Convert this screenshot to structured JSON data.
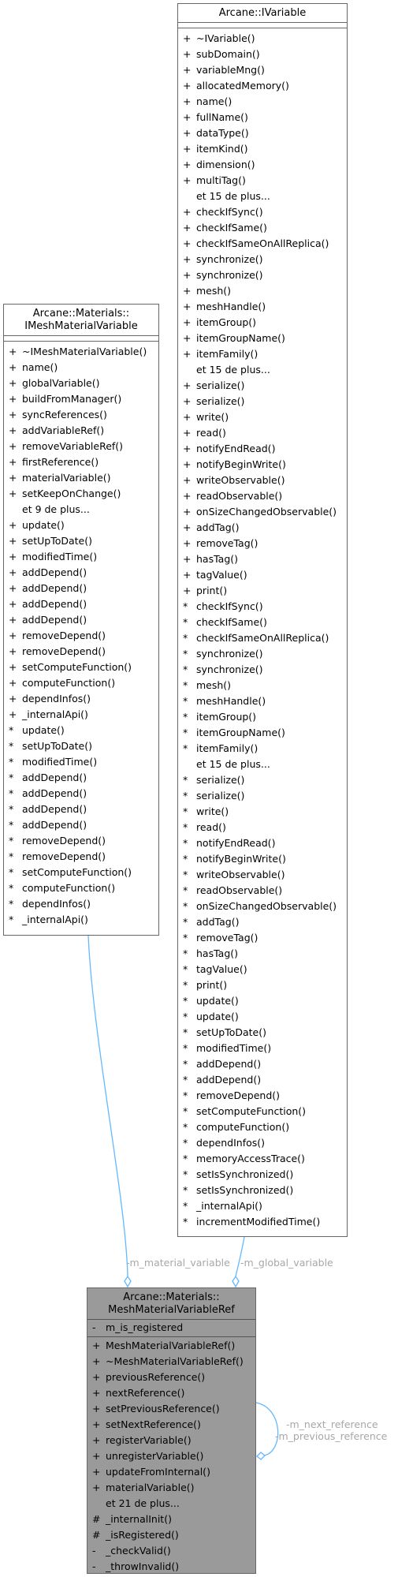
{
  "ivariable": {
    "title": "Arcane::IVariable",
    "methods": [
      {
        "v": "+",
        "n": "~IVariable()"
      },
      {
        "v": "+",
        "n": "subDomain()"
      },
      {
        "v": "+",
        "n": "variableMng()"
      },
      {
        "v": "+",
        "n": "allocatedMemory()"
      },
      {
        "v": "+",
        "n": "name()"
      },
      {
        "v": "+",
        "n": "fullName()"
      },
      {
        "v": "+",
        "n": "dataType()"
      },
      {
        "v": "+",
        "n": "itemKind()"
      },
      {
        "v": "+",
        "n": "dimension()"
      },
      {
        "v": "+",
        "n": "multiTag()"
      },
      {
        "v": "",
        "n": "et 15 de plus..."
      },
      {
        "v": "+",
        "n": "checkIfSync()"
      },
      {
        "v": "+",
        "n": "checkIfSame()"
      },
      {
        "v": "+",
        "n": "checkIfSameOnAllReplica()"
      },
      {
        "v": "+",
        "n": "synchronize()"
      },
      {
        "v": "+",
        "n": "synchronize()"
      },
      {
        "v": "+",
        "n": "mesh()"
      },
      {
        "v": "+",
        "n": "meshHandle()"
      },
      {
        "v": "+",
        "n": "itemGroup()"
      },
      {
        "v": "+",
        "n": "itemGroupName()"
      },
      {
        "v": "+",
        "n": "itemFamily()"
      },
      {
        "v": "",
        "n": "et 15 de plus..."
      },
      {
        "v": "+",
        "n": "serialize()"
      },
      {
        "v": "+",
        "n": "serialize()"
      },
      {
        "v": "+",
        "n": "write()"
      },
      {
        "v": "+",
        "n": "read()"
      },
      {
        "v": "+",
        "n": "notifyEndRead()"
      },
      {
        "v": "+",
        "n": "notifyBeginWrite()"
      },
      {
        "v": "+",
        "n": "writeObservable()"
      },
      {
        "v": "+",
        "n": "readObservable()"
      },
      {
        "v": "+",
        "n": "onSizeChangedObservable()"
      },
      {
        "v": "+",
        "n": "addTag()"
      },
      {
        "v": "+",
        "n": "removeTag()"
      },
      {
        "v": "+",
        "n": "hasTag()"
      },
      {
        "v": "+",
        "n": "tagValue()"
      },
      {
        "v": "+",
        "n": "print()"
      },
      {
        "v": "*",
        "n": "checkIfSync()"
      },
      {
        "v": "*",
        "n": "checkIfSame()"
      },
      {
        "v": "*",
        "n": "checkIfSameOnAllReplica()"
      },
      {
        "v": "*",
        "n": "synchronize()"
      },
      {
        "v": "*",
        "n": "synchronize()"
      },
      {
        "v": "*",
        "n": "mesh()"
      },
      {
        "v": "*",
        "n": "meshHandle()"
      },
      {
        "v": "*",
        "n": "itemGroup()"
      },
      {
        "v": "*",
        "n": "itemGroupName()"
      },
      {
        "v": "*",
        "n": "itemFamily()"
      },
      {
        "v": "",
        "n": "et 15 de plus..."
      },
      {
        "v": "*",
        "n": "serialize()"
      },
      {
        "v": "*",
        "n": "serialize()"
      },
      {
        "v": "*",
        "n": "write()"
      },
      {
        "v": "*",
        "n": "read()"
      },
      {
        "v": "*",
        "n": "notifyEndRead()"
      },
      {
        "v": "*",
        "n": "notifyBeginWrite()"
      },
      {
        "v": "*",
        "n": "writeObservable()"
      },
      {
        "v": "*",
        "n": "readObservable()"
      },
      {
        "v": "*",
        "n": "onSizeChangedObservable()"
      },
      {
        "v": "*",
        "n": "addTag()"
      },
      {
        "v": "*",
        "n": "removeTag()"
      },
      {
        "v": "*",
        "n": "hasTag()"
      },
      {
        "v": "*",
        "n": "tagValue()"
      },
      {
        "v": "*",
        "n": "print()"
      },
      {
        "v": "*",
        "n": "update()"
      },
      {
        "v": "*",
        "n": "update()"
      },
      {
        "v": "*",
        "n": "setUpToDate()"
      },
      {
        "v": "*",
        "n": "modifiedTime()"
      },
      {
        "v": "*",
        "n": "addDepend()"
      },
      {
        "v": "*",
        "n": "addDepend()"
      },
      {
        "v": "*",
        "n": "removeDepend()"
      },
      {
        "v": "*",
        "n": "setComputeFunction()"
      },
      {
        "v": "*",
        "n": "computeFunction()"
      },
      {
        "v": "*",
        "n": "dependInfos()"
      },
      {
        "v": "*",
        "n": "memoryAccessTrace()"
      },
      {
        "v": "*",
        "n": "setIsSynchronized()"
      },
      {
        "v": "*",
        "n": "setIsSynchronized()"
      },
      {
        "v": "*",
        "n": "_internalApi()"
      },
      {
        "v": "*",
        "n": "incrementModifiedTime()"
      }
    ]
  },
  "imeshmaterialvariable": {
    "title_line1": "Arcane::Materials::",
    "title_line2": "IMeshMaterialVariable",
    "methods": [
      {
        "v": "+",
        "n": "~IMeshMaterialVariable()"
      },
      {
        "v": "+",
        "n": "name()"
      },
      {
        "v": "+",
        "n": "globalVariable()"
      },
      {
        "v": "+",
        "n": "buildFromManager()"
      },
      {
        "v": "+",
        "n": "syncReferences()"
      },
      {
        "v": "+",
        "n": "addVariableRef()"
      },
      {
        "v": "+",
        "n": "removeVariableRef()"
      },
      {
        "v": "+",
        "n": "firstReference()"
      },
      {
        "v": "+",
        "n": "materialVariable()"
      },
      {
        "v": "+",
        "n": "setKeepOnChange()"
      },
      {
        "v": "",
        "n": "et 9 de plus..."
      },
      {
        "v": "+",
        "n": "update()"
      },
      {
        "v": "+",
        "n": "setUpToDate()"
      },
      {
        "v": "+",
        "n": "modifiedTime()"
      },
      {
        "v": "+",
        "n": "addDepend()"
      },
      {
        "v": "+",
        "n": "addDepend()"
      },
      {
        "v": "+",
        "n": "addDepend()"
      },
      {
        "v": "+",
        "n": "addDepend()"
      },
      {
        "v": "+",
        "n": "removeDepend()"
      },
      {
        "v": "+",
        "n": "removeDepend()"
      },
      {
        "v": "+",
        "n": "setComputeFunction()"
      },
      {
        "v": "+",
        "n": "computeFunction()"
      },
      {
        "v": "+",
        "n": "dependInfos()"
      },
      {
        "v": "+",
        "n": "_internalApi()"
      },
      {
        "v": "*",
        "n": "update()"
      },
      {
        "v": "*",
        "n": "setUpToDate()"
      },
      {
        "v": "*",
        "n": "modifiedTime()"
      },
      {
        "v": "*",
        "n": "addDepend()"
      },
      {
        "v": "*",
        "n": "addDepend()"
      },
      {
        "v": "*",
        "n": "addDepend()"
      },
      {
        "v": "*",
        "n": "addDepend()"
      },
      {
        "v": "*",
        "n": "removeDepend()"
      },
      {
        "v": "*",
        "n": "removeDepend()"
      },
      {
        "v": "*",
        "n": "setComputeFunction()"
      },
      {
        "v": "*",
        "n": "computeFunction()"
      },
      {
        "v": "*",
        "n": "dependInfos()"
      },
      {
        "v": "*",
        "n": "_internalApi()"
      }
    ]
  },
  "meshmaterialvariableref": {
    "title_line1": "Arcane::Materials::",
    "title_line2": "MeshMaterialVariableRef",
    "attributes": [
      {
        "v": "-",
        "n": "m_is_registered"
      }
    ],
    "methods": [
      {
        "v": "+",
        "n": "MeshMaterialVariableRef()"
      },
      {
        "v": "+",
        "n": "~MeshMaterialVariableRef()"
      },
      {
        "v": "+",
        "n": "previousReference()"
      },
      {
        "v": "+",
        "n": "nextReference()"
      },
      {
        "v": "+",
        "n": "setPreviousReference()"
      },
      {
        "v": "+",
        "n": "setNextReference()"
      },
      {
        "v": "+",
        "n": "registerVariable()"
      },
      {
        "v": "+",
        "n": "unregisterVariable()"
      },
      {
        "v": "+",
        "n": "updateFromInternal()"
      },
      {
        "v": "+",
        "n": "materialVariable()"
      },
      {
        "v": "",
        "n": "et 21 de plus..."
      },
      {
        "v": "#",
        "n": "_internalInit()"
      },
      {
        "v": "#",
        "n": "_isRegistered()"
      },
      {
        "v": "-",
        "n": "_checkValid()"
      },
      {
        "v": "-",
        "n": "_throwInvalid()"
      }
    ]
  },
  "edges": {
    "material_variable": "-m_material_variable",
    "global_variable": "-m_global_variable",
    "next_reference": "-m_next_reference",
    "previous_reference": "-m_previous_reference"
  },
  "colors": {
    "edge": "#63b8ff",
    "label": "#a7a7a7",
    "focus_box": "#9a9a9a"
  }
}
